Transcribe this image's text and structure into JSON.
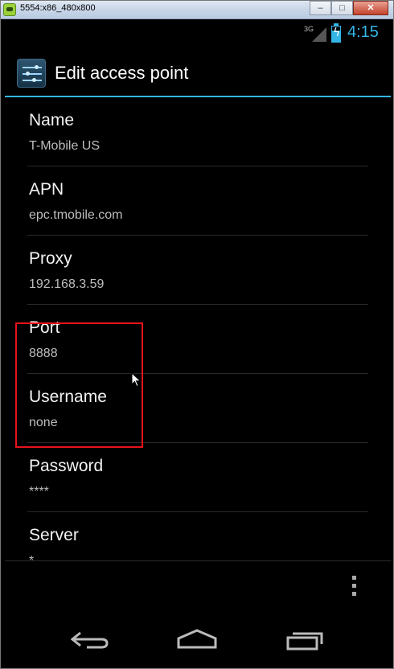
{
  "window": {
    "title": "5554:x86_480x800",
    "minimize_label": "–",
    "maximize_label": "□",
    "close_label": "✕"
  },
  "statusbar": {
    "network": "3G",
    "time": "4:15"
  },
  "actionbar": {
    "icon": "settings-sliders-icon",
    "title": "Edit access point"
  },
  "fields": [
    {
      "title": "Name",
      "value": "T-Mobile US"
    },
    {
      "title": "APN",
      "value": "epc.tmobile.com"
    },
    {
      "title": "Proxy",
      "value": "192.168.3.59"
    },
    {
      "title": "Port",
      "value": "8888"
    },
    {
      "title": "Username",
      "value": "none"
    },
    {
      "title": "Password",
      "value": "****"
    },
    {
      "title": "Server",
      "value": "*"
    }
  ],
  "colors": {
    "accent": "#33b5e5",
    "highlight_box": "#e8121a",
    "background": "#000000"
  },
  "navbar": {
    "back": "back-icon",
    "home": "home-icon",
    "recents": "recent-apps-icon"
  }
}
